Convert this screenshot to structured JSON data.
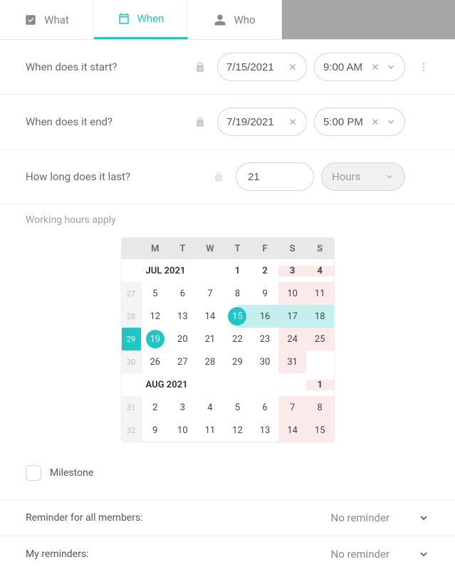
{
  "tabs": {
    "what": "What",
    "when": "When",
    "who": "Who",
    "active": "when"
  },
  "rows": {
    "start_label": "When does it start?",
    "end_label": "When does it end?",
    "duration_label": "How long does it last?",
    "working_hours": "Working hours apply"
  },
  "start": {
    "date": "7/15/2021",
    "time": "9:00 AM"
  },
  "end": {
    "date": "7/19/2021",
    "time": "5:00 PM"
  },
  "duration": {
    "value": "21",
    "unit": "Hours"
  },
  "calendar": {
    "dow": [
      "M",
      "T",
      "W",
      "T",
      "F",
      "S",
      "S"
    ],
    "month1_label": "JUL 2021",
    "month2_label": "AUG 2021",
    "weeks": {
      "jul_m_row": {
        "d1": "1",
        "d2": "2",
        "d3": "3",
        "d4": "4"
      },
      "w27": {
        "no": "27",
        "d": [
          "5",
          "6",
          "7",
          "8",
          "9",
          "10",
          "11"
        ]
      },
      "w28": {
        "no": "28",
        "d": [
          "12",
          "13",
          "14",
          "15",
          "16",
          "17",
          "18"
        ]
      },
      "w29": {
        "no": "29",
        "d": [
          "19",
          "20",
          "21",
          "22",
          "23",
          "24",
          "25"
        ]
      },
      "w30": {
        "no": "30",
        "d": [
          "26",
          "27",
          "28",
          "29",
          "30",
          "31",
          ""
        ]
      },
      "aug_m_row": {
        "d": "1"
      },
      "w31": {
        "no": "31",
        "d": [
          "2",
          "3",
          "4",
          "5",
          "6",
          "7",
          "8"
        ]
      },
      "w32": {
        "no": "32",
        "d": [
          "9",
          "10",
          "11",
          "12",
          "13",
          "14",
          "15"
        ]
      }
    }
  },
  "milestone": {
    "label": "Milestone",
    "checked": false
  },
  "reminders": {
    "all_label": "Reminder for all members:",
    "all_value": "No reminder",
    "my_label": "My reminders:",
    "my_value": "No reminder"
  }
}
